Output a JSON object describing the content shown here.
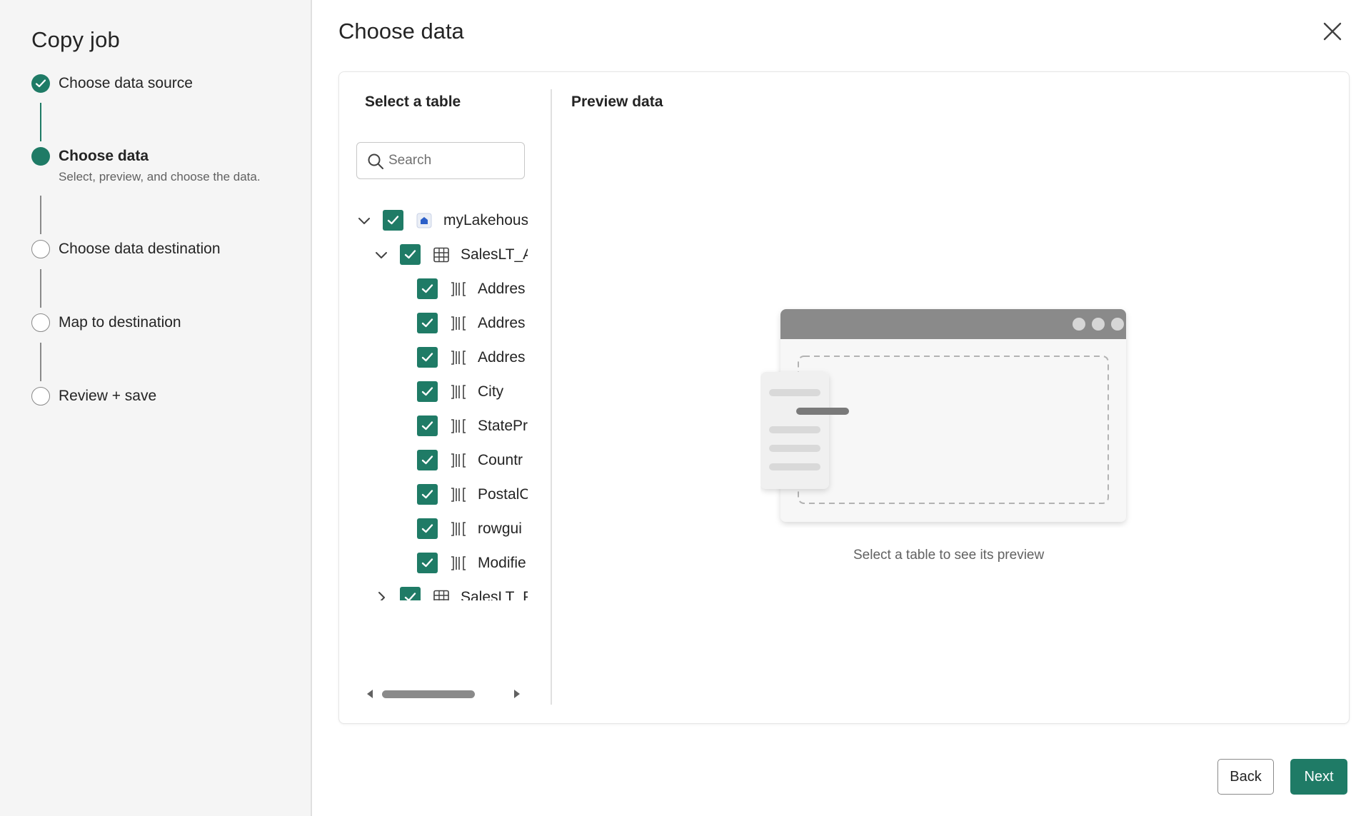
{
  "sidebar": {
    "title": "Copy job",
    "steps": [
      {
        "label": "Choose data source",
        "state": "done"
      },
      {
        "label": "Choose data",
        "state": "current",
        "description": "Select, preview, and choose the data."
      },
      {
        "label": "Choose data destination",
        "state": "todo"
      },
      {
        "label": "Map to destination",
        "state": "todo"
      },
      {
        "label": "Review + save",
        "state": "todo"
      }
    ]
  },
  "main": {
    "title": "Choose data",
    "close_icon": "close-icon"
  },
  "tree_pane": {
    "title": "Select a table",
    "search_placeholder": "Search",
    "rows": [
      {
        "label": "myLakehous",
        "type": "lakehouse",
        "checked": true,
        "expanded": true
      },
      {
        "label": "SalesLT_A",
        "type": "table",
        "checked": true,
        "expanded": true
      },
      {
        "label": "Addres",
        "type": "column",
        "checked": true
      },
      {
        "label": "Addres",
        "type": "column",
        "checked": true
      },
      {
        "label": "Addres",
        "type": "column",
        "checked": true
      },
      {
        "label": "City",
        "type": "column",
        "checked": true
      },
      {
        "label": "StatePr",
        "type": "column",
        "checked": true
      },
      {
        "label": "Countr",
        "type": "column",
        "checked": true
      },
      {
        "label": "PostalC",
        "type": "column",
        "checked": true
      },
      {
        "label": "rowgui",
        "type": "column",
        "checked": true
      },
      {
        "label": "Modifie",
        "type": "column",
        "checked": true
      },
      {
        "label": "SalesLT_Pr",
        "type": "table",
        "checked": true,
        "expanded": false
      }
    ]
  },
  "preview_pane": {
    "title": "Preview data",
    "hint": "Select a table to see its preview"
  },
  "footer": {
    "back_label": "Back",
    "next_label": "Next"
  },
  "colors": {
    "accent": "#1f7b66",
    "sidebar_bg": "#f5f5f5"
  }
}
